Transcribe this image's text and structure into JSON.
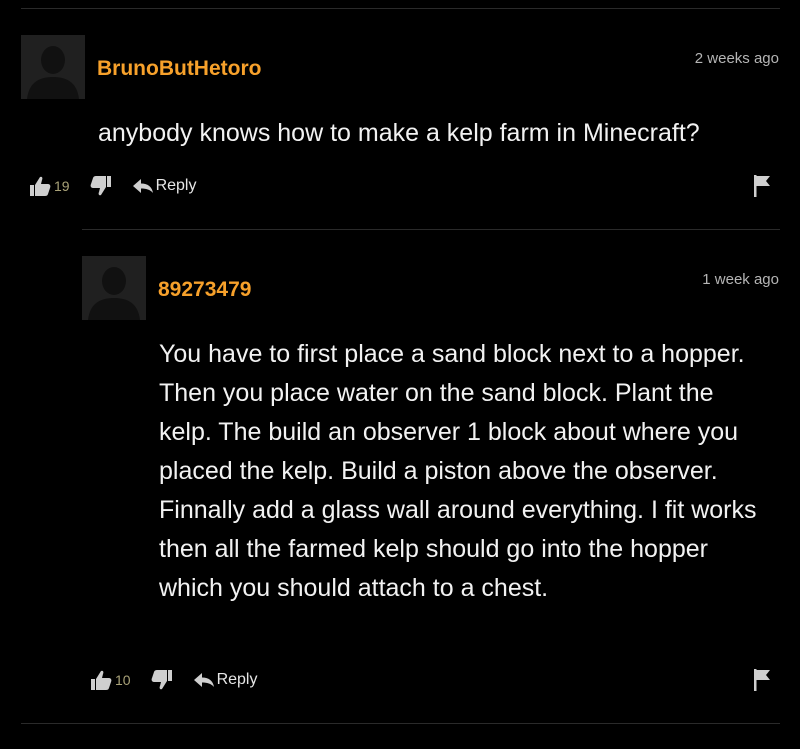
{
  "comments": [
    {
      "username": "BrunoButHetoro",
      "timestamp": "2 weeks ago",
      "body": "anybody knows how to make a kelp farm in Minecraft?",
      "upvotes": "19",
      "reply_label": "Reply"
    },
    {
      "username": "89273479",
      "timestamp": "1 week ago",
      "body": "You have to first place a sand block next to a hopper. Then you place water on the sand block. Plant the kelp. The build an observer 1 block about where you placed the kelp. Build a piston above the observer. Finnally add a glass wall around everything. I fit works then all the farmed kelp should go into the hopper which you should attach to a chest.",
      "upvotes": "10",
      "reply_label": "Reply"
    }
  ],
  "colors": {
    "background": "#000000",
    "username": "#f7a12b",
    "timestamp": "#b5b5b5",
    "body": "#f2f2f2",
    "vote_count": "#a9a278",
    "icon": "#cfcfcf"
  },
  "icons": {
    "thumb_up": "thumbs-up-icon",
    "thumb_down": "thumbs-down-icon",
    "reply": "reply-arrow-icon",
    "flag": "flag-icon",
    "avatar": "default-avatar-icon"
  }
}
